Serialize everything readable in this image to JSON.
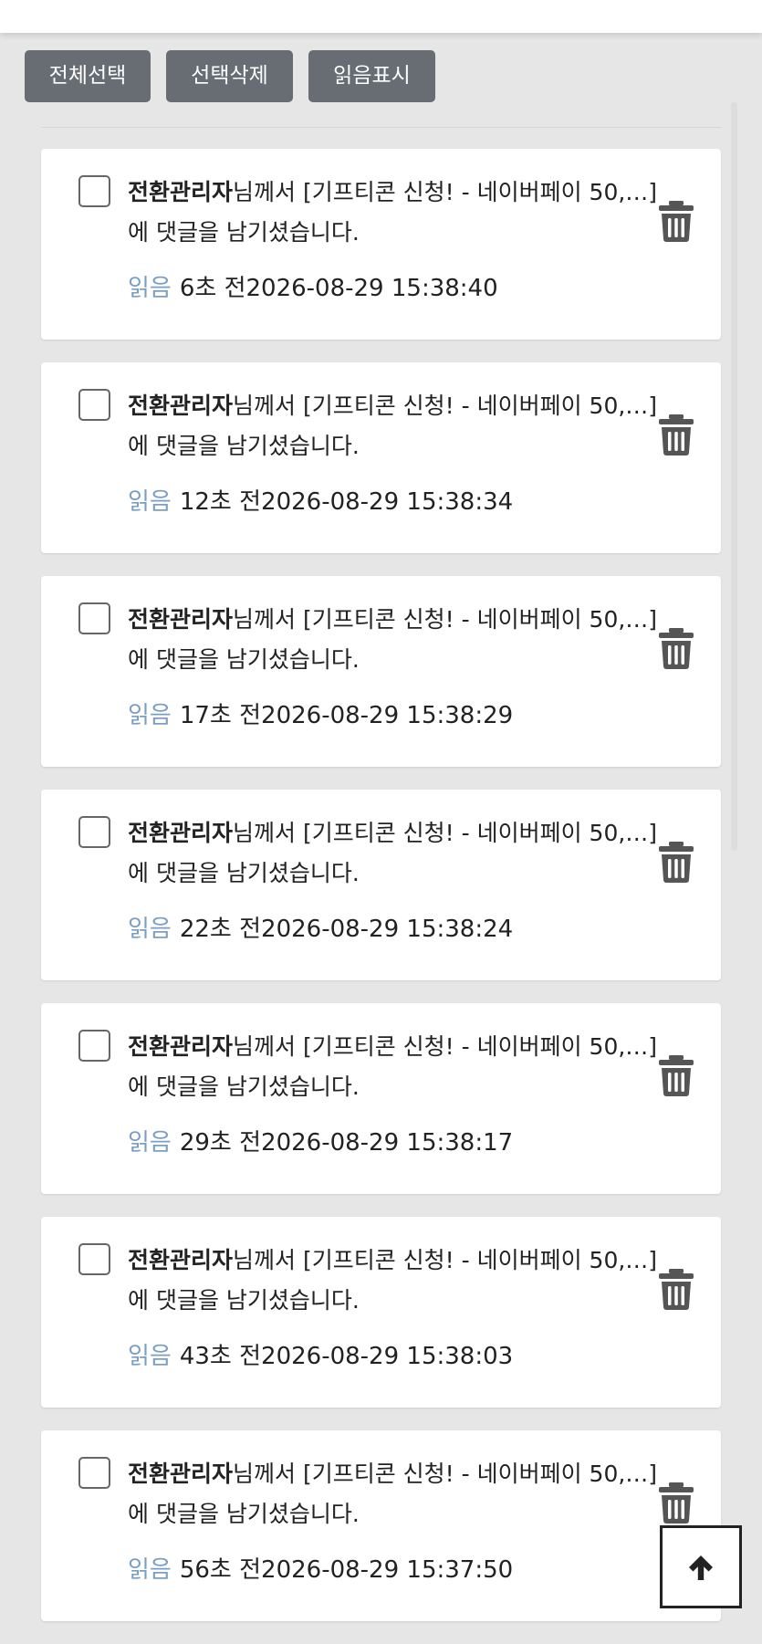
{
  "toolbar": {
    "select_all_label": "전체선택",
    "delete_selected_label": "선택삭제",
    "mark_read_label": "읽음표시"
  },
  "notifications": [
    {
      "sender": "전환관리자",
      "message": "님께서 [기프티콘 신청! - 네이버페이 50,…] 에 댓글을 남기셨습니다.",
      "status": "읽음",
      "time": "6초 전2026-08-29 15:38:40"
    },
    {
      "sender": "전환관리자",
      "message": "님께서 [기프티콘 신청! - 네이버페이 50,…] 에 댓글을 남기셨습니다.",
      "status": "읽음",
      "time": "12초 전2026-08-29 15:38:34"
    },
    {
      "sender": "전환관리자",
      "message": "님께서 [기프티콘 신청! - 네이버페이 50,…] 에 댓글을 남기셨습니다.",
      "status": "읽음",
      "time": "17초 전2026-08-29 15:38:29"
    },
    {
      "sender": "전환관리자",
      "message": "님께서 [기프티콘 신청! - 네이버페이 50,…] 에 댓글을 남기셨습니다.",
      "status": "읽음",
      "time": "22초 전2026-08-29 15:38:24"
    },
    {
      "sender": "전환관리자",
      "message": "님께서 [기프티콘 신청! - 네이버페이 50,…] 에 댓글을 남기셨습니다.",
      "status": "읽음",
      "time": "29초 전2026-08-29 15:38:17"
    },
    {
      "sender": "전환관리자",
      "message": "님께서 [기프티콘 신청! - 네이버페이 50,…] 에 댓글을 남기셨습니다.",
      "status": "읽음",
      "time": "43초 전2026-08-29 15:38:03"
    },
    {
      "sender": "전환관리자",
      "message": "님께서 [기프티콘 신청! - 네이버페이 50,…] 에 댓글을 남기셨습니다.",
      "status": "읽음",
      "time": "56초 전2026-08-29 15:37:50"
    }
  ],
  "icons": {
    "delete": "trash-icon",
    "scroll_top": "arrow-up-icon"
  },
  "colors": {
    "button_bg": "#676d73",
    "read_status": "#7b9fc3",
    "page_bg": "#e6e6e6"
  }
}
